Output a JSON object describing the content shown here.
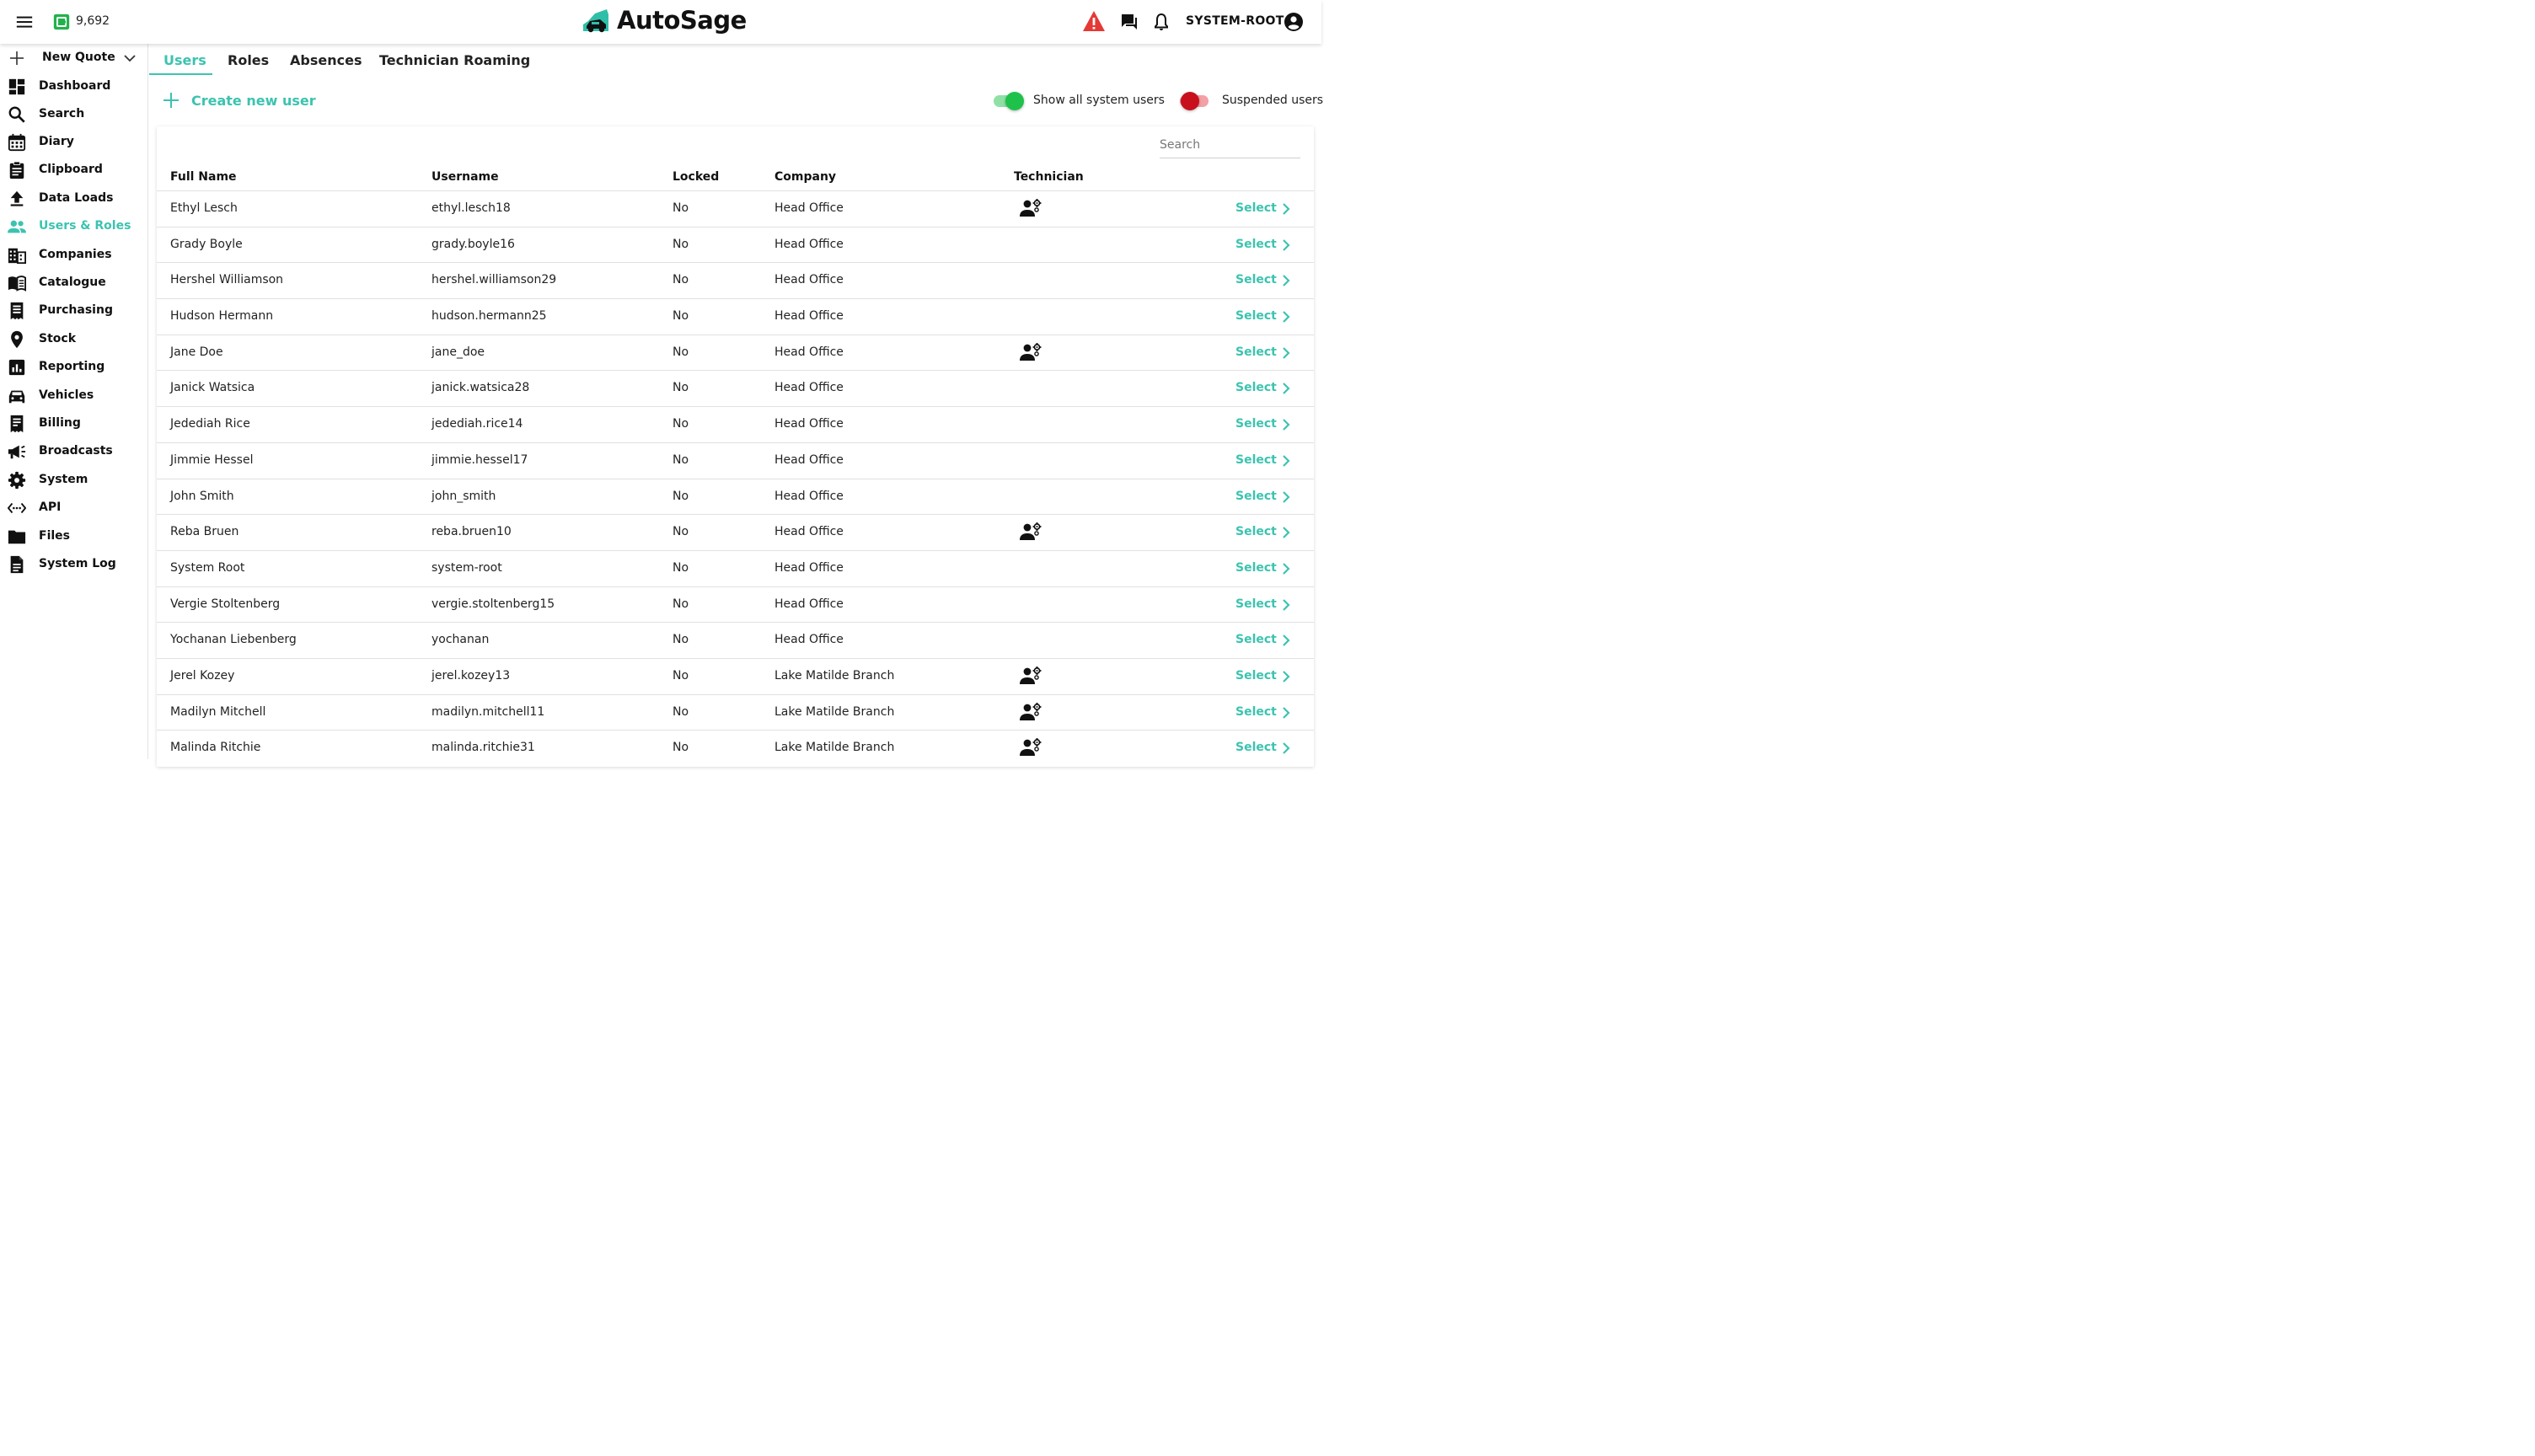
{
  "header": {
    "credits": "9,692",
    "brand": "AutoSage",
    "user": "SYSTEM-ROOT",
    "icons": [
      "menu-icon",
      "credit-icon",
      "warning-icon",
      "chat-icon",
      "bell-icon",
      "account-icon"
    ],
    "colors": {
      "accent": "#3cc3b0",
      "warning": "#e53935",
      "credit": "#22b24c"
    }
  },
  "sidebar": {
    "new_quote": "New Quote",
    "items": [
      {
        "label": "Dashboard",
        "icon": "dashboard-icon"
      },
      {
        "label": "Search",
        "icon": "search-icon"
      },
      {
        "label": "Diary",
        "icon": "calendar-icon"
      },
      {
        "label": "Clipboard",
        "icon": "clipboard-icon"
      },
      {
        "label": "Data Loads",
        "icon": "upload-icon"
      },
      {
        "label": "Users & Roles",
        "icon": "users-icon",
        "active": true
      },
      {
        "label": "Companies",
        "icon": "building-icon"
      },
      {
        "label": "Catalogue",
        "icon": "book-icon"
      },
      {
        "label": "Purchasing",
        "icon": "receipt-icon"
      },
      {
        "label": "Stock",
        "icon": "location-pin-icon"
      },
      {
        "label": "Reporting",
        "icon": "chart-icon"
      },
      {
        "label": "Vehicles",
        "icon": "car-icon"
      },
      {
        "label": "Billing",
        "icon": "invoice-icon"
      },
      {
        "label": "Broadcasts",
        "icon": "megaphone-icon"
      },
      {
        "label": "System",
        "icon": "gear-icon"
      },
      {
        "label": "API",
        "icon": "code-icon"
      },
      {
        "label": "Files",
        "icon": "folder-icon"
      },
      {
        "label": "System Log",
        "icon": "document-icon"
      }
    ]
  },
  "tabs": [
    {
      "label": "Users",
      "active": true
    },
    {
      "label": "Roles"
    },
    {
      "label": "Absences"
    },
    {
      "label": "Technician Roaming"
    }
  ],
  "actions": {
    "create_user": "Create new user",
    "show_system_users": {
      "label": "Show all system users",
      "on": true,
      "color": "#1ec24a"
    },
    "suspended_users": {
      "label": "Suspended users",
      "on": false,
      "color": "#c8101d"
    }
  },
  "table": {
    "search_placeholder": "Search",
    "columns": [
      "Full Name",
      "Username",
      "Locked",
      "Company",
      "Technician"
    ],
    "select_label": "Select",
    "rows": [
      {
        "name": "Ethyl Lesch",
        "username": "ethyl.lesch18",
        "locked": "No",
        "company": "Head Office",
        "technician": true
      },
      {
        "name": "Grady Boyle",
        "username": "grady.boyle16",
        "locked": "No",
        "company": "Head Office",
        "technician": false
      },
      {
        "name": "Hershel Williamson",
        "username": "hershel.williamson29",
        "locked": "No",
        "company": "Head Office",
        "technician": false
      },
      {
        "name": "Hudson Hermann",
        "username": "hudson.hermann25",
        "locked": "No",
        "company": "Head Office",
        "technician": false
      },
      {
        "name": "Jane Doe",
        "username": "jane_doe",
        "locked": "No",
        "company": "Head Office",
        "technician": true
      },
      {
        "name": "Janick Watsica",
        "username": "janick.watsica28",
        "locked": "No",
        "company": "Head Office",
        "technician": false
      },
      {
        "name": "Jedediah Rice",
        "username": "jedediah.rice14",
        "locked": "No",
        "company": "Head Office",
        "technician": false
      },
      {
        "name": "Jimmie Hessel",
        "username": "jimmie.hessel17",
        "locked": "No",
        "company": "Head Office",
        "technician": false
      },
      {
        "name": "John Smith",
        "username": "john_smith",
        "locked": "No",
        "company": "Head Office",
        "technician": false
      },
      {
        "name": "Reba Bruen",
        "username": "reba.bruen10",
        "locked": "No",
        "company": "Head Office",
        "technician": true
      },
      {
        "name": "System Root",
        "username": "system-root",
        "locked": "No",
        "company": "Head Office",
        "technician": false
      },
      {
        "name": "Vergie Stoltenberg",
        "username": "vergie.stoltenberg15",
        "locked": "No",
        "company": "Head Office",
        "technician": false
      },
      {
        "name": "Yochanan Liebenberg",
        "username": "yochanan",
        "locked": "No",
        "company": "Head Office",
        "technician": false
      },
      {
        "name": "Jerel Kozey",
        "username": "jerel.kozey13",
        "locked": "No",
        "company": "Lake Matilde Branch",
        "technician": true
      },
      {
        "name": "Madilyn Mitchell",
        "username": "madilyn.mitchell11",
        "locked": "No",
        "company": "Lake Matilde Branch",
        "technician": true
      },
      {
        "name": "Malinda Ritchie",
        "username": "malinda.ritchie31",
        "locked": "No",
        "company": "Lake Matilde Branch",
        "technician": true
      }
    ]
  }
}
